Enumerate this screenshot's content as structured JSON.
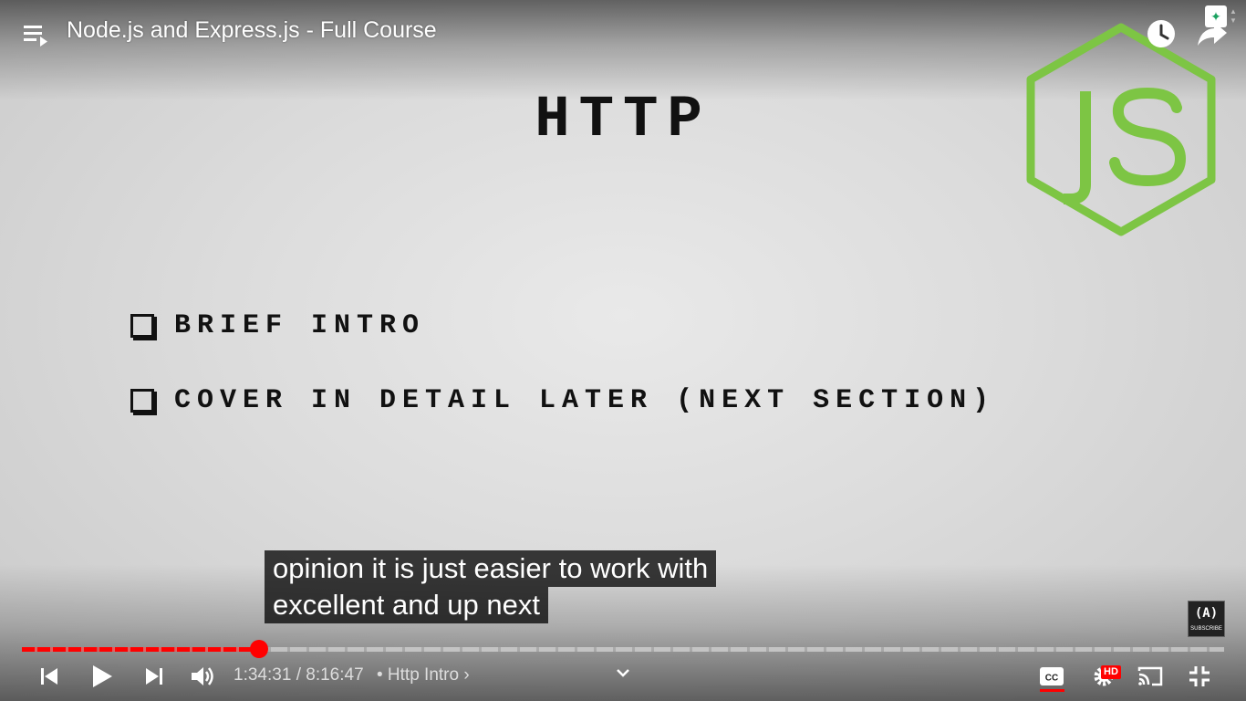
{
  "header": {
    "video_title": "Node.js and Express.js - Full Course"
  },
  "slide": {
    "title": "HTTP",
    "bullets": [
      "BRIEF INTRO",
      "COVER IN DETAIL LATER (NEXT SECTION)"
    ],
    "logo_text": "JS",
    "logo_color": "#7dc544"
  },
  "captions": {
    "lines": [
      "opinion it is just easier to work with",
      "excellent and up next"
    ]
  },
  "watermark": {
    "glyph": "(A)",
    "label": "SUBSCRIBE"
  },
  "controls": {
    "current_time": "1:34:31",
    "separator": "/",
    "duration": "8:16:47",
    "chapter": "• Http Intro ›",
    "progress_fraction": 0.197,
    "hd_label": "HD",
    "accent_color": "#ff0000"
  }
}
